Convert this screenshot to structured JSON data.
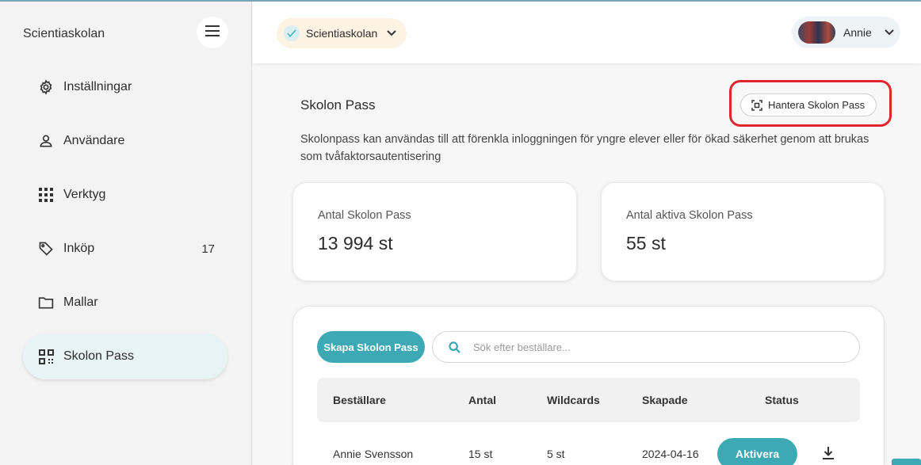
{
  "sidebar": {
    "brand": "Scientiaskolan",
    "items": [
      {
        "label": "Inställningar",
        "icon": "gear-icon"
      },
      {
        "label": "Användare",
        "icon": "person-icon"
      },
      {
        "label": "Verktyg",
        "icon": "grid-icon"
      },
      {
        "label": "Inköp",
        "icon": "tag-icon",
        "badge": "17"
      },
      {
        "label": "Mallar",
        "icon": "folder-icon"
      },
      {
        "label": "Skolon Pass",
        "icon": "qr-code-icon",
        "active": true
      }
    ]
  },
  "header": {
    "school_name": "Scientiaskolan",
    "user_name": "Annie"
  },
  "main": {
    "title": "Skolon Pass",
    "manage_button": "Hantera Skolon Pass",
    "description": "Skolonpass kan användas till att förenkla inloggningen för yngre elever eller för ökad säkerhet genom att brukas som tvåfaktorsautentisering",
    "stats": [
      {
        "label": "Antal Skolon Pass",
        "value": "13 994 st"
      },
      {
        "label": "Antal aktiva Skolon Pass",
        "value": "55 st"
      }
    ],
    "create_button": "Skapa Skolon Pass",
    "search_placeholder": "Sök efter beställare...",
    "table": {
      "headers": [
        "Beställare",
        "Antal",
        "Wildcards",
        "Skapade",
        "Status"
      ],
      "rows": [
        {
          "orderer": "Annie Svensson",
          "count": "15 st",
          "wildcards": "5 st",
          "created": "2024-04-16",
          "action": "Aktivera"
        }
      ]
    }
  },
  "colors": {
    "accent": "#3da9b5",
    "highlight_ring": "#e0262c",
    "active_nav_bg": "#e8f3f6",
    "school_pill_bg": "#fdf3e3"
  }
}
